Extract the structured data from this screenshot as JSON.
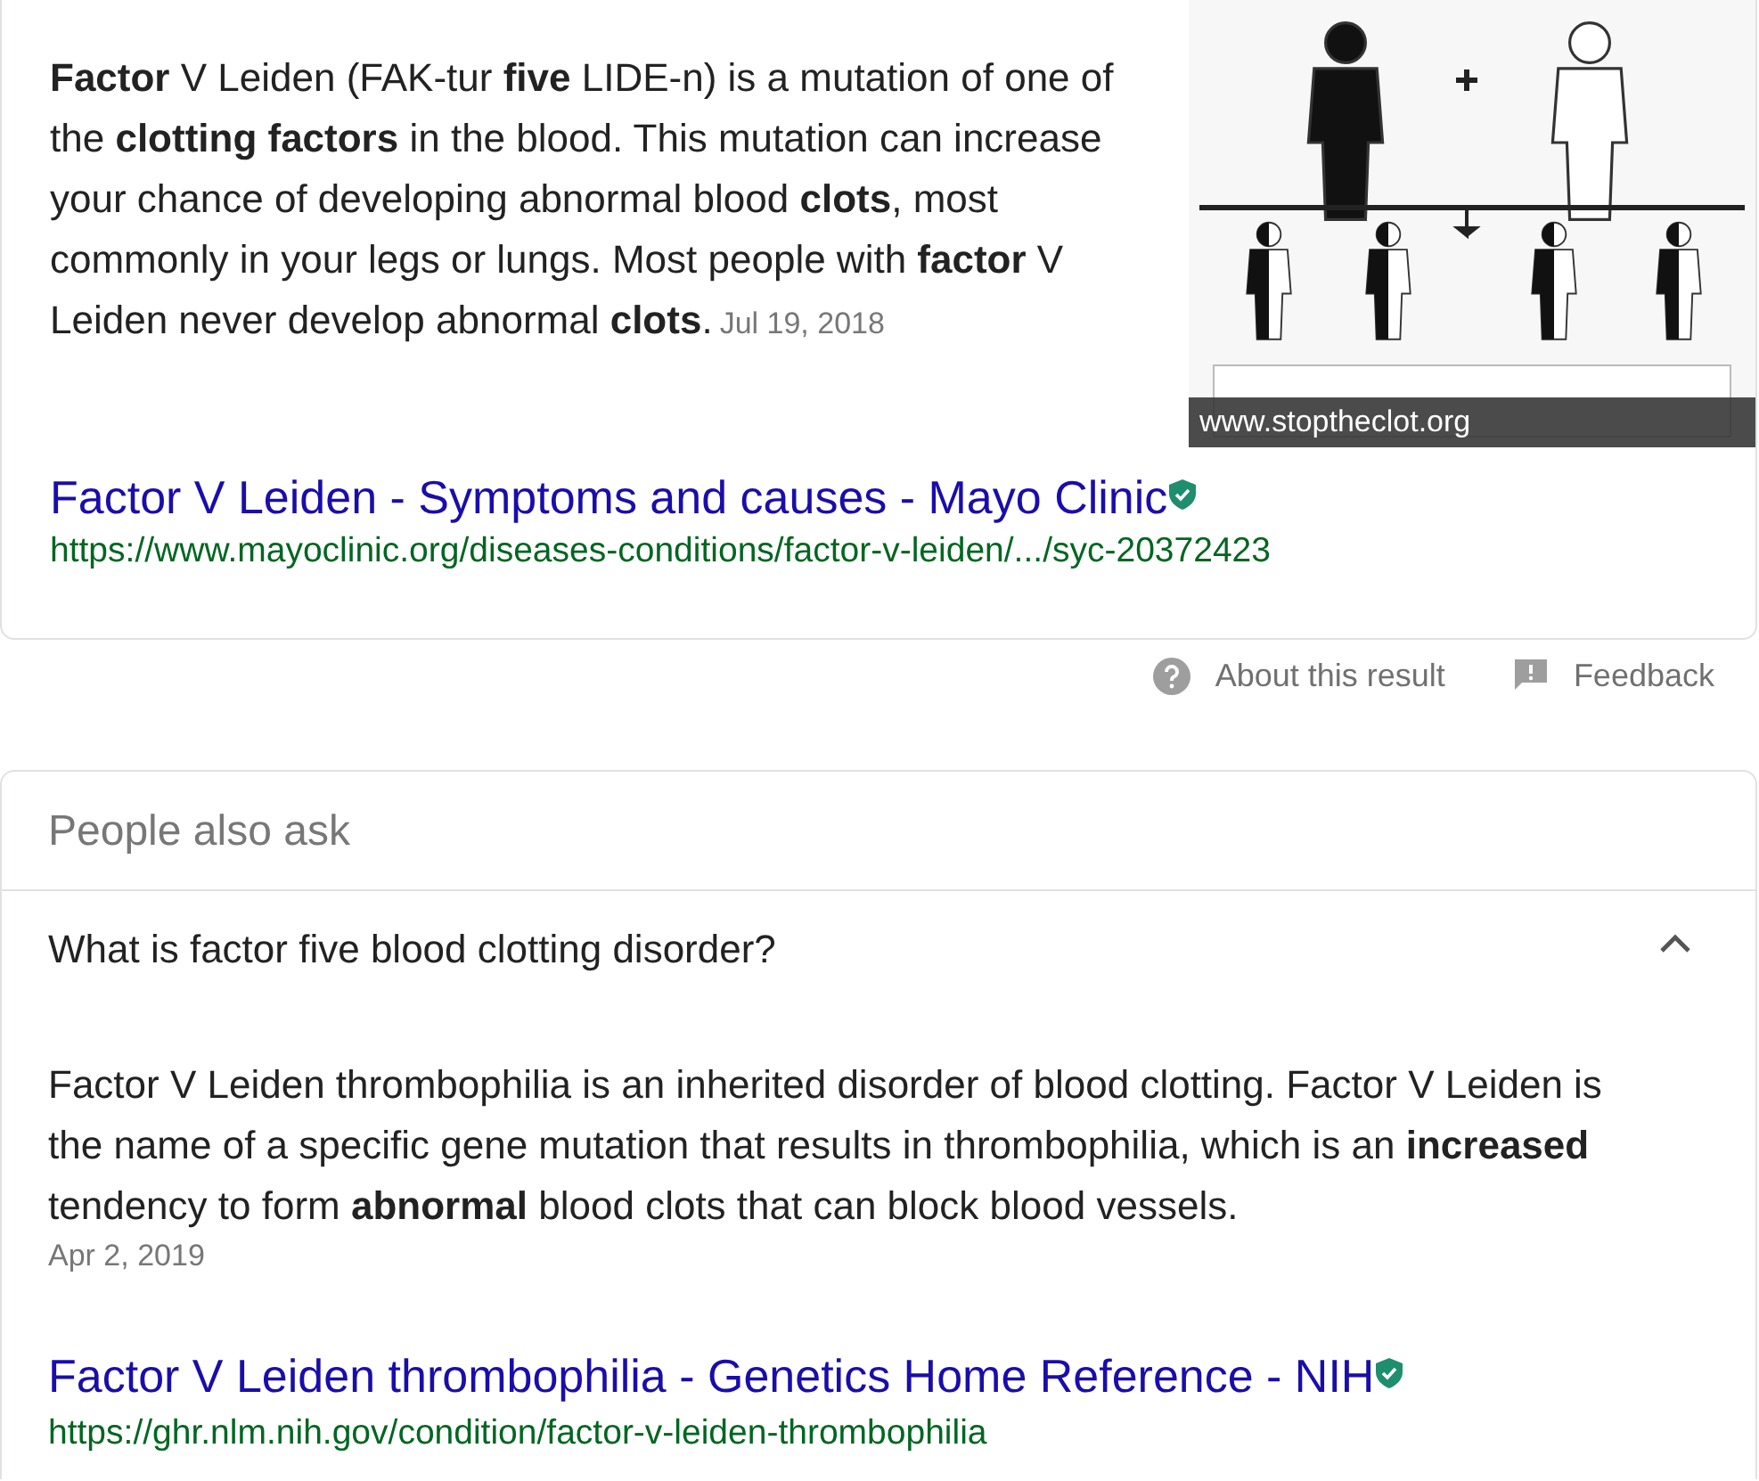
{
  "snippet": {
    "text": "**Factor** V Leiden (FAK-tur **five** LIDE-n) is a mutation of one of the **clotting factors** in the blood. This mutation can increase your chance of developing abnormal blood **clots**, most commonly in your legs or lungs. Most people with **factor** V Leiden never develop abnormal **clots**.",
    "date": "Jul 19, 2018",
    "image": {
      "kind": "picture",
      "caption": "www.stoptheclot.org"
    }
  },
  "result": {
    "title": "Factor V Leiden - Symptoms and causes - Mayo Clinic",
    "verified": true,
    "url": "https://www.mayoclinic.org/diseases-conditions/factor-v-leiden/.../syc-20372423"
  },
  "actions": [
    {
      "kind": "about",
      "label": "About this result"
    },
    {
      "kind": "feedback",
      "label": "Feedback"
    }
  ],
  "people_also_ask": {
    "heading": "People also ask",
    "questions": [
      {
        "question": "What is factor five blood clotting disorder?",
        "expanded": true,
        "answer": "Factor V Leiden thrombophilia is an inherited disorder of blood clotting. Factor V Leiden is the name of a specific gene mutation that results in thrombophilia, which is an **increased** tendency to form **abnormal** blood clots that can block blood vessels.",
        "date": "Apr 2, 2019",
        "title": "Factor V Leiden thrombophilia - Genetics Home Reference - NIH",
        "verified": true,
        "url": "https://ghr.nlm.nih.gov/condition/factor-v-leiden-thrombophilia"
      }
    ]
  }
}
